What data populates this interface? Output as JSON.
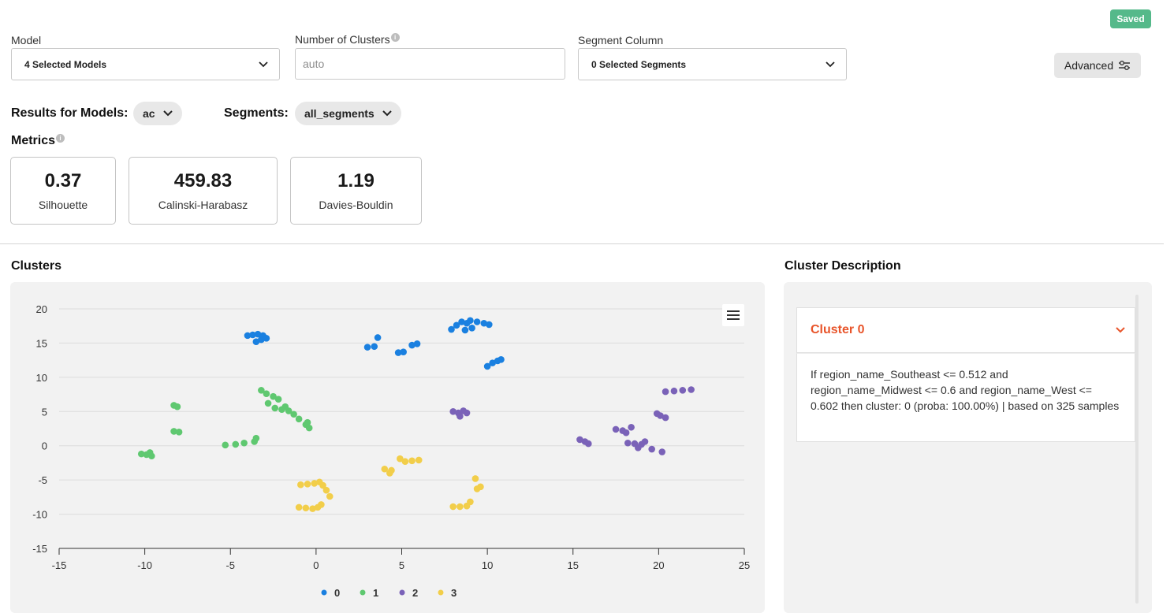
{
  "status": {
    "saved_label": "Saved",
    "saved_color": "#55b98a"
  },
  "controls": {
    "model": {
      "label": "Model",
      "value": "4 Selected Models"
    },
    "clusters": {
      "label": "Number of Clusters",
      "placeholder": "auto"
    },
    "segment": {
      "label": "Segment Column",
      "value": "0 Selected Segments"
    },
    "advanced_label": "Advanced"
  },
  "results": {
    "models_label": "Results for Models:",
    "model_value": "ac",
    "segments_label": "Segments:",
    "segment_value": "all_segments"
  },
  "metrics": {
    "title": "Metrics",
    "items": [
      {
        "value": "0.37",
        "label": "Silhouette"
      },
      {
        "value": "459.83",
        "label": "Calinski-Harabasz"
      },
      {
        "value": "1.19",
        "label": "Davies-Bouldin"
      }
    ]
  },
  "clusters_panel": {
    "title": "Clusters"
  },
  "description": {
    "title": "Cluster Description",
    "cluster_title": "Cluster 0",
    "text": "If region_name_Southeast <= 0.512 and region_name_Midwest <= 0.6 and region_name_West <= 0.602 then cluster: 0 (proba: 100.00%) | based on 325 samples",
    "accent_color": "#e8552b"
  },
  "chart_data": {
    "type": "scatter",
    "xlim": [
      -15,
      25
    ],
    "ylim": [
      -15,
      20
    ],
    "x_ticks": [
      -15,
      -10,
      -5,
      0,
      5,
      10,
      15,
      20,
      25
    ],
    "y_ticks": [
      20,
      15,
      10,
      5,
      0,
      -5,
      -10,
      -15
    ],
    "grid": "horizontal",
    "legend_position": "bottom",
    "series": [
      {
        "name": "0",
        "color": "#1a80e0",
        "points": [
          [
            -4,
            16.1
          ],
          [
            -3.7,
            16.2
          ],
          [
            -3.4,
            16.3
          ],
          [
            -3.1,
            16.1
          ],
          [
            -3.5,
            15.2
          ],
          [
            -3.2,
            15.5
          ],
          [
            -2.9,
            15.7
          ],
          [
            3,
            14.4
          ],
          [
            3.4,
            14.5
          ],
          [
            3.6,
            15.8
          ],
          [
            4.8,
            13.6
          ],
          [
            5.1,
            13.7
          ],
          [
            5.6,
            14.7
          ],
          [
            5.9,
            14.9
          ],
          [
            7.9,
            17
          ],
          [
            8.2,
            17.6
          ],
          [
            8.5,
            18.1
          ],
          [
            8.8,
            17.9
          ],
          [
            9,
            18.3
          ],
          [
            9.4,
            18.1
          ],
          [
            9.8,
            17.9
          ],
          [
            10.1,
            17.7
          ],
          [
            8.7,
            16.9
          ],
          [
            9.1,
            17.2
          ],
          [
            10,
            11.6
          ],
          [
            10.3,
            12.1
          ],
          [
            10.6,
            12.4
          ],
          [
            10.8,
            12.6
          ]
        ]
      },
      {
        "name": "1",
        "color": "#5fc870",
        "points": [
          [
            -10.2,
            -1.2
          ],
          [
            -9.9,
            -1.3
          ],
          [
            -9.6,
            -1.5
          ],
          [
            -9.7,
            -1
          ],
          [
            -8.3,
            5.9
          ],
          [
            -8.1,
            5.7
          ],
          [
            -8.3,
            2.1
          ],
          [
            -8,
            2
          ],
          [
            -5.3,
            0.1
          ],
          [
            -4.7,
            0.2
          ],
          [
            -4.2,
            0.4
          ],
          [
            -3.6,
            0.6
          ],
          [
            -3.5,
            1.1
          ],
          [
            -3.2,
            8.1
          ],
          [
            -2.9,
            7.6
          ],
          [
            -2.5,
            7.2
          ],
          [
            -2.2,
            6.8
          ],
          [
            -2.8,
            6.2
          ],
          [
            -2.4,
            5.5
          ],
          [
            -2,
            5.3
          ],
          [
            -1.6,
            5.1
          ],
          [
            -1.8,
            5.7
          ],
          [
            -1.3,
            4.6
          ],
          [
            -1,
            3.9
          ],
          [
            -0.6,
            3.1
          ],
          [
            -0.4,
            2.6
          ],
          [
            -0.5,
            3.4
          ]
        ]
      },
      {
        "name": "2",
        "color": "#7a62b8",
        "points": [
          [
            8,
            5
          ],
          [
            8.3,
            4.8
          ],
          [
            8.6,
            5.1
          ],
          [
            8.8,
            4.8
          ],
          [
            8.4,
            4.3
          ],
          [
            15.4,
            0.9
          ],
          [
            15.7,
            0.6
          ],
          [
            15.9,
            0.3
          ],
          [
            17.5,
            2.4
          ],
          [
            17.9,
            2.2
          ],
          [
            18.1,
            1.9
          ],
          [
            18.4,
            2.7
          ],
          [
            18.2,
            0.4
          ],
          [
            18.6,
            0.3
          ],
          [
            19,
            0.2
          ],
          [
            19.2,
            0.6
          ],
          [
            18.8,
            -0.3
          ],
          [
            19.6,
            -0.5
          ],
          [
            20.2,
            -0.9
          ],
          [
            19.9,
            4.7
          ],
          [
            20.1,
            4.4
          ],
          [
            20.4,
            4.1
          ],
          [
            20.4,
            7.9
          ],
          [
            20.9,
            8
          ],
          [
            21.4,
            8.1
          ],
          [
            21.9,
            8.2
          ]
        ]
      },
      {
        "name": "3",
        "color": "#f2ce4a",
        "points": [
          [
            -1,
            -9
          ],
          [
            -0.6,
            -9.1
          ],
          [
            -0.2,
            -9.2
          ],
          [
            0.1,
            -9
          ],
          [
            0.3,
            -8.6
          ],
          [
            -0.9,
            -5.7
          ],
          [
            -0.5,
            -5.6
          ],
          [
            -0.1,
            -5.5
          ],
          [
            0.2,
            -5.3
          ],
          [
            0.4,
            -5.8
          ],
          [
            0.6,
            -6.5
          ],
          [
            0.8,
            -7.4
          ],
          [
            4,
            -3.4
          ],
          [
            4.4,
            -3.6
          ],
          [
            4.3,
            -4
          ],
          [
            4.9,
            -1.9
          ],
          [
            5.2,
            -2.3
          ],
          [
            5.6,
            -2.2
          ],
          [
            6,
            -2.1
          ],
          [
            8,
            -8.9
          ],
          [
            8.4,
            -8.9
          ],
          [
            8.8,
            -8.8
          ],
          [
            9,
            -8.2
          ],
          [
            9.3,
            -4.8
          ],
          [
            9.4,
            -6.3
          ],
          [
            9.6,
            -6
          ]
        ]
      }
    ]
  }
}
